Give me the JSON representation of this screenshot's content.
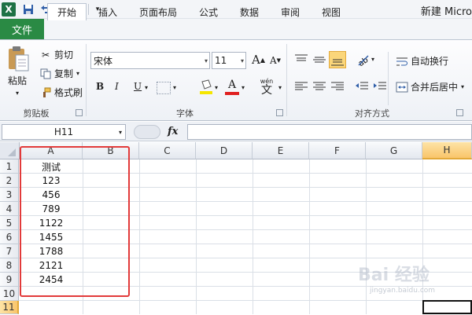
{
  "app": {
    "title": "新建 Micro",
    "icon_letter": "X"
  },
  "quick_access": [
    "save-icon",
    "undo-icon",
    "redo-icon",
    "customize-icon"
  ],
  "tabs": {
    "file": "文件",
    "home": "开始",
    "insert": "插入",
    "page_layout": "页面布局",
    "formulas": "公式",
    "data": "数据",
    "review": "审阅",
    "view": "视图"
  },
  "clipboard": {
    "paste": "粘贴",
    "cut": "剪切",
    "copy": "复制",
    "format_painter": "格式刷",
    "label": "剪贴板"
  },
  "font": {
    "name": "宋体",
    "size": "11",
    "label": "字体",
    "bold": "B",
    "italic": "I",
    "underline": "U",
    "grow": "A",
    "shrink": "A",
    "wen": "wén",
    "wen_char": "文",
    "font_color_letter": "A"
  },
  "alignment": {
    "wrap_text": "自动换行",
    "merge_center": "合并后居中",
    "label": "对齐方式"
  },
  "formula_bar": {
    "name_box": "H11",
    "fx": "fx",
    "value": ""
  },
  "sheet": {
    "columns": [
      "A",
      "B",
      "C",
      "D",
      "E",
      "F",
      "G",
      "H"
    ],
    "rows": [
      "1",
      "2",
      "3",
      "4",
      "5",
      "6",
      "7",
      "8",
      "9",
      "10",
      "11"
    ],
    "column_a_values": [
      "测试",
      "123",
      "456",
      "789",
      "1122",
      "1455",
      "1788",
      "2121",
      "2454",
      "",
      ""
    ],
    "active_column": "H",
    "active_row": "11"
  },
  "watermark": {
    "text": "Bai 经验",
    "url": "jingyan.baidu.com"
  },
  "colors": {
    "file_tab": "#2a8a44",
    "active_header": "#f9c56a",
    "highlight": "#e23a3a"
  }
}
